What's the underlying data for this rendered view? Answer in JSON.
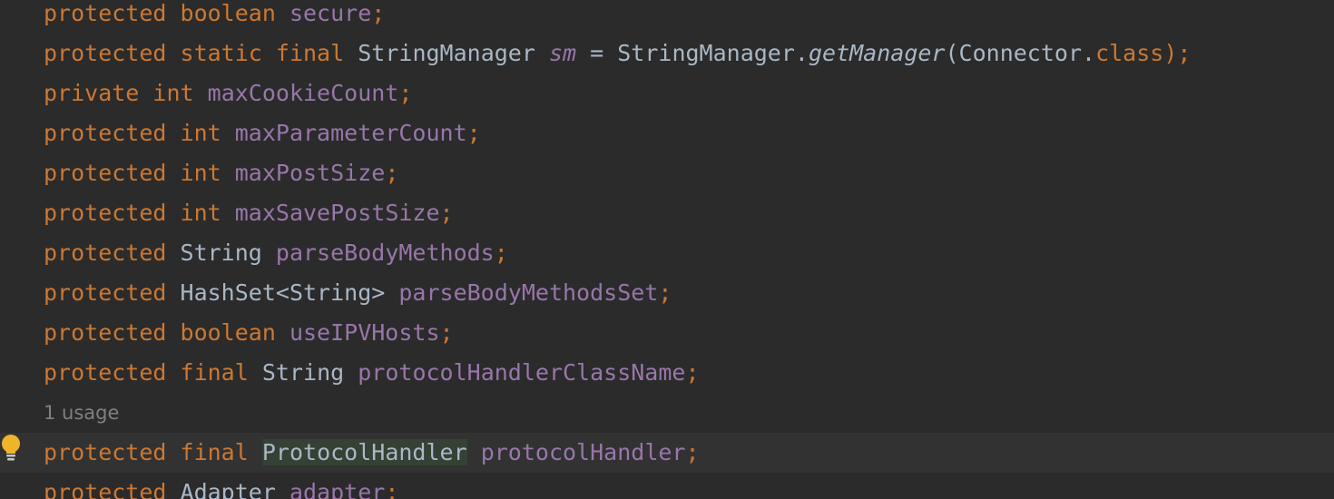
{
  "editor": {
    "lines": [
      {
        "tokens": [
          {
            "text": "protected",
            "cls": "k"
          },
          {
            "text": " "
          },
          {
            "text": "boolean",
            "cls": "k"
          },
          {
            "text": " "
          },
          {
            "text": "secure",
            "cls": "f"
          },
          {
            "text": ";",
            "cls": "semi"
          }
        ]
      },
      {
        "tokens": [
          {
            "text": "protected",
            "cls": "k"
          },
          {
            "text": " "
          },
          {
            "text": "static",
            "cls": "k"
          },
          {
            "text": " "
          },
          {
            "text": "final",
            "cls": "k"
          },
          {
            "text": " "
          },
          {
            "text": "StringManager",
            "cls": "t"
          },
          {
            "text": " "
          },
          {
            "text": "sm",
            "cls": "fi"
          },
          {
            "text": " = ",
            "cls": "p"
          },
          {
            "text": "StringManager",
            "cls": "t"
          },
          {
            "text": ".",
            "cls": "p"
          },
          {
            "text": "getManager",
            "cls": "mi"
          },
          {
            "text": "(",
            "cls": "p"
          },
          {
            "text": "Connector",
            "cls": "t"
          },
          {
            "text": ".",
            "cls": "p"
          },
          {
            "text": "class",
            "cls": "k"
          },
          {
            "text": ");",
            "cls": "semi"
          }
        ]
      },
      {
        "tokens": [
          {
            "text": "private",
            "cls": "k"
          },
          {
            "text": " "
          },
          {
            "text": "int",
            "cls": "k"
          },
          {
            "text": " "
          },
          {
            "text": "maxCookieCount",
            "cls": "f"
          },
          {
            "text": ";",
            "cls": "semi"
          }
        ]
      },
      {
        "tokens": [
          {
            "text": "protected",
            "cls": "k"
          },
          {
            "text": " "
          },
          {
            "text": "int",
            "cls": "k"
          },
          {
            "text": " "
          },
          {
            "text": "maxParameterCount",
            "cls": "f"
          },
          {
            "text": ";",
            "cls": "semi"
          }
        ]
      },
      {
        "tokens": [
          {
            "text": "protected",
            "cls": "k"
          },
          {
            "text": " "
          },
          {
            "text": "int",
            "cls": "k"
          },
          {
            "text": " "
          },
          {
            "text": "maxPostSize",
            "cls": "f"
          },
          {
            "text": ";",
            "cls": "semi"
          }
        ]
      },
      {
        "tokens": [
          {
            "text": "protected",
            "cls": "k"
          },
          {
            "text": " "
          },
          {
            "text": "int",
            "cls": "k"
          },
          {
            "text": " "
          },
          {
            "text": "maxSavePostSize",
            "cls": "f"
          },
          {
            "text": ";",
            "cls": "semi"
          }
        ]
      },
      {
        "tokens": [
          {
            "text": "protected",
            "cls": "k"
          },
          {
            "text": " "
          },
          {
            "text": "String",
            "cls": "t"
          },
          {
            "text": " "
          },
          {
            "text": "parseBodyMethods",
            "cls": "f"
          },
          {
            "text": ";",
            "cls": "semi"
          }
        ]
      },
      {
        "tokens": [
          {
            "text": "protected",
            "cls": "k"
          },
          {
            "text": " "
          },
          {
            "text": "HashSet<String>",
            "cls": "t"
          },
          {
            "text": " "
          },
          {
            "text": "parseBodyMethodsSet",
            "cls": "f"
          },
          {
            "text": ";",
            "cls": "semi"
          }
        ]
      },
      {
        "tokens": [
          {
            "text": "protected",
            "cls": "k"
          },
          {
            "text": " "
          },
          {
            "text": "boolean",
            "cls": "k"
          },
          {
            "text": " "
          },
          {
            "text": "useIPVHosts",
            "cls": "f"
          },
          {
            "text": ";",
            "cls": "semi"
          }
        ]
      },
      {
        "tokens": [
          {
            "text": "protected",
            "cls": "k"
          },
          {
            "text": " "
          },
          {
            "text": "final",
            "cls": "k"
          },
          {
            "text": " "
          },
          {
            "text": "String",
            "cls": "t"
          },
          {
            "text": " "
          },
          {
            "text": "protocolHandlerClassName",
            "cls": "f"
          },
          {
            "text": ";",
            "cls": "semi"
          }
        ]
      },
      {
        "tokens": [
          {
            "text": "protected",
            "cls": "k"
          },
          {
            "text": " "
          },
          {
            "text": "final",
            "cls": "k"
          },
          {
            "text": " "
          },
          {
            "text": "ProtocolHandler",
            "cls": "t highlight"
          },
          {
            "text": " "
          },
          {
            "text": "protocolHandler",
            "cls": "f"
          },
          {
            "text": ";",
            "cls": "semi"
          }
        ]
      },
      {
        "tokens": [
          {
            "text": "protected",
            "cls": "k"
          },
          {
            "text": " "
          },
          {
            "text": "Adapter",
            "cls": "t"
          },
          {
            "text": " "
          },
          {
            "text": "adapter",
            "cls": "f"
          },
          {
            "text": ";",
            "cls": "semi"
          }
        ]
      }
    ],
    "usage_hint": "1 usage",
    "current_line_index": 10,
    "gutter_icon": "intention-bulb-icon",
    "colors": {
      "background": "#2b2b2b",
      "current_line": "#323232",
      "keyword": "#cc7832",
      "type": "#a9b7c6",
      "field": "#9876aa",
      "hint": "#808080",
      "identifier_highlight": "#344134",
      "bulb": "#f0b429"
    }
  }
}
